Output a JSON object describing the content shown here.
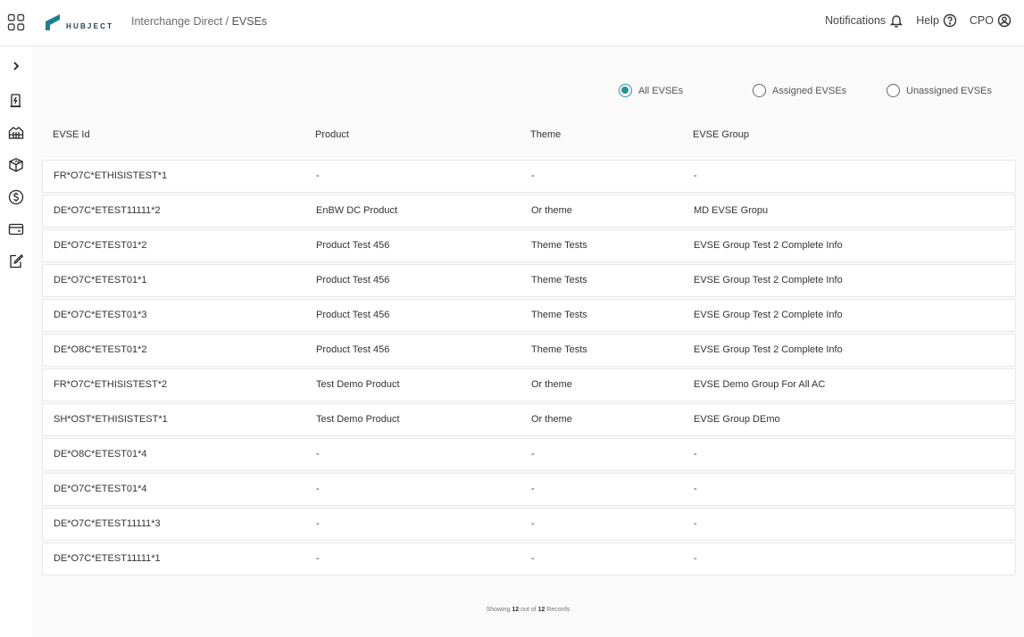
{
  "header": {
    "logo_text": "HUBJECT",
    "breadcrumb_parent": "Interchange Direct",
    "breadcrumb_separator": " / ",
    "breadcrumb_current": "EVSEs",
    "notifications_label": "Notifications",
    "help_label": "Help",
    "user_label": "CPO"
  },
  "sidebar": {
    "items": [
      {
        "icon": "chevron-right-icon"
      },
      {
        "icon": "charging-station-icon"
      },
      {
        "icon": "building-icon"
      },
      {
        "icon": "package-icon"
      },
      {
        "icon": "dollar-icon"
      },
      {
        "icon": "wallet-icon"
      },
      {
        "icon": "edit-icon"
      }
    ]
  },
  "filters": {
    "all_label": "All EVSEs",
    "assigned_label": "Assigned EVSEs",
    "unassigned_label": "Unassigned EVSEs",
    "selected": "All EVSEs"
  },
  "table": {
    "headers": [
      "EVSE Id",
      "Product",
      "Theme",
      "EVSE Group"
    ],
    "rows": [
      {
        "evse_id": "FR*O7C*ETHISISTEST*1",
        "product": "-",
        "theme": "-",
        "group": "-"
      },
      {
        "evse_id": "DE*O7C*ETEST11111*2",
        "product": "EnBW DC Product",
        "theme": "Or theme",
        "group": "MD EVSE Gropu"
      },
      {
        "evse_id": "DE*O7C*ETEST01*2",
        "product": "Product Test 456",
        "theme": "Theme Tests",
        "group": "EVSE Group Test 2 Complete Info"
      },
      {
        "evse_id": "DE*O7C*ETEST01*1",
        "product": "Product Test 456",
        "theme": "Theme Tests",
        "group": "EVSE Group Test 2 Complete Info"
      },
      {
        "evse_id": "DE*O7C*ETEST01*3",
        "product": "Product Test 456",
        "theme": "Theme Tests",
        "group": "EVSE Group Test 2 Complete Info"
      },
      {
        "evse_id": "DE*O8C*ETEST01*2",
        "product": "Product Test 456",
        "theme": "Theme Tests",
        "group": "EVSE Group Test 2 Complete Info"
      },
      {
        "evse_id": "FR*O7C*ETHISISTEST*2",
        "product": "Test Demo Product",
        "theme": "Or theme",
        "group": "EVSE Demo Group For All AC"
      },
      {
        "evse_id": "SH*OST*ETHISISTEST*1",
        "product": "Test Demo Product",
        "theme": "Or theme",
        "group": "EVSE Group DEmo"
      },
      {
        "evse_id": "DE*O8C*ETEST01*4",
        "product": "-",
        "theme": "-",
        "group": "-"
      },
      {
        "evse_id": "DE*O7C*ETEST01*4",
        "product": "-",
        "theme": "-",
        "group": "-"
      },
      {
        "evse_id": "DE*O7C*ETEST11111*3",
        "product": "-",
        "theme": "-",
        "group": "-"
      },
      {
        "evse_id": "DE*O7C*ETEST11111*1",
        "product": "-",
        "theme": "-",
        "group": "-"
      }
    ]
  },
  "footer": {
    "showing": "Showing",
    "count": "12",
    "out_of": "out of",
    "total": "12",
    "records": "Records"
  },
  "colors": {
    "accent": "#2a8f9d",
    "logo": "#1f7f8c",
    "background": "#fafafa"
  }
}
